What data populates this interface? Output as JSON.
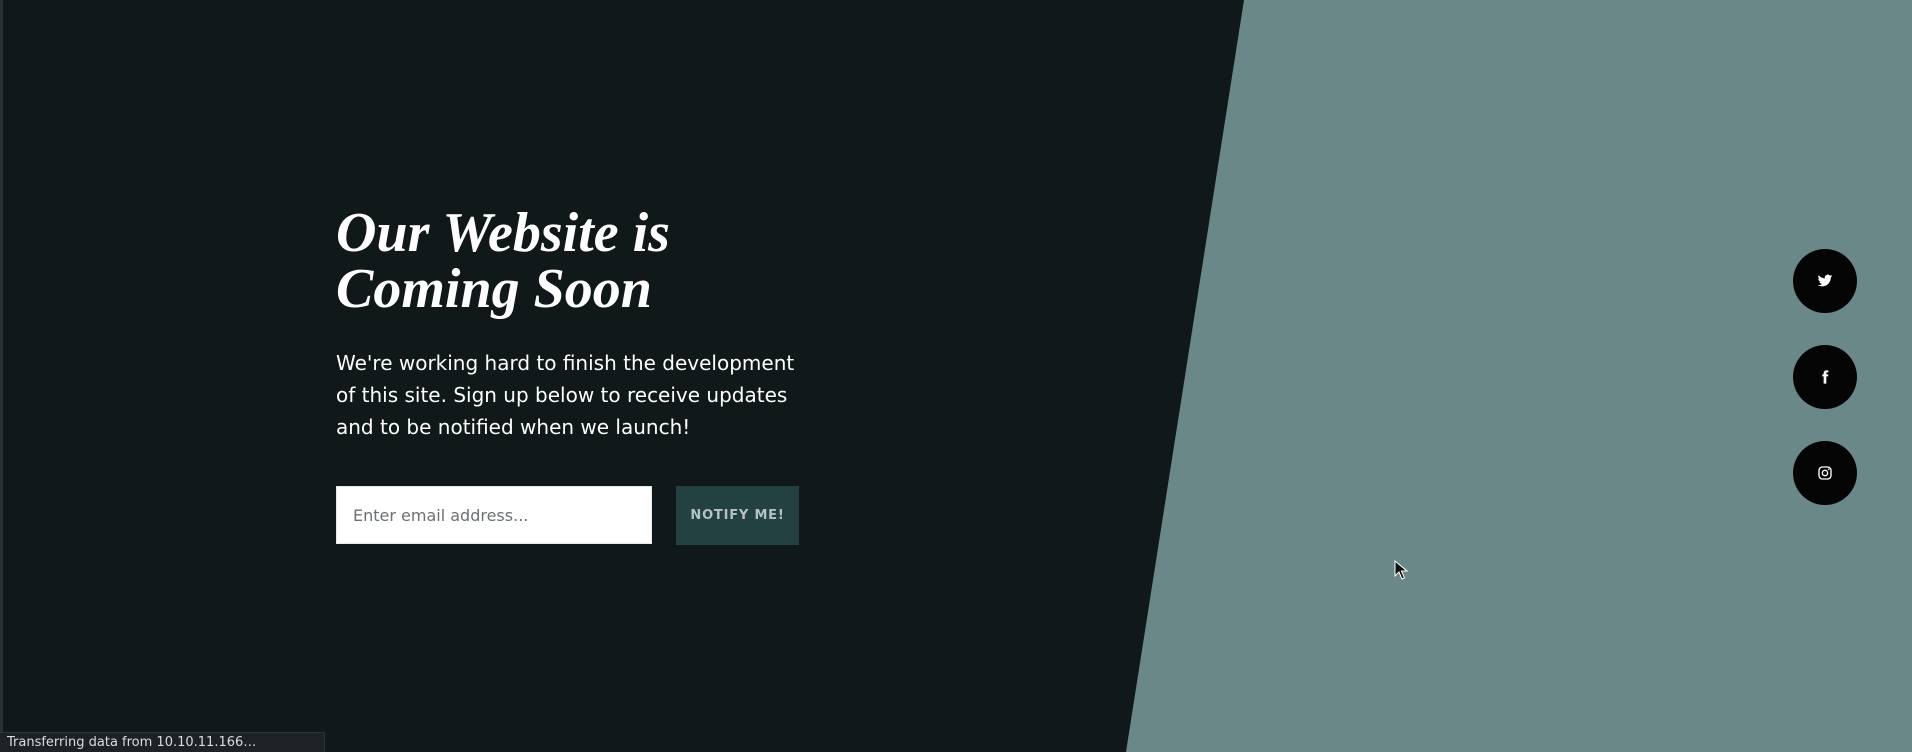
{
  "hero": {
    "title": "Our Website is Coming Soon",
    "description": "We're working hard to finish the development of this site. Sign up below to receive updates and to be notified when we launch!"
  },
  "signup": {
    "email_placeholder": "Enter email address...",
    "button_label": "NOTIFY ME!"
  },
  "social": [
    {
      "name": "twitter",
      "icon": "twitter-icon"
    },
    {
      "name": "facebook",
      "icon": "facebook-icon"
    },
    {
      "name": "instagram",
      "icon": "instagram-icon"
    }
  ],
  "status": {
    "text": "Transferring data from 10.10.11.166…"
  },
  "colors": {
    "background": "#111819",
    "accent_panel": "#6a8887",
    "button": "#244141",
    "social_circle": "#050505"
  }
}
